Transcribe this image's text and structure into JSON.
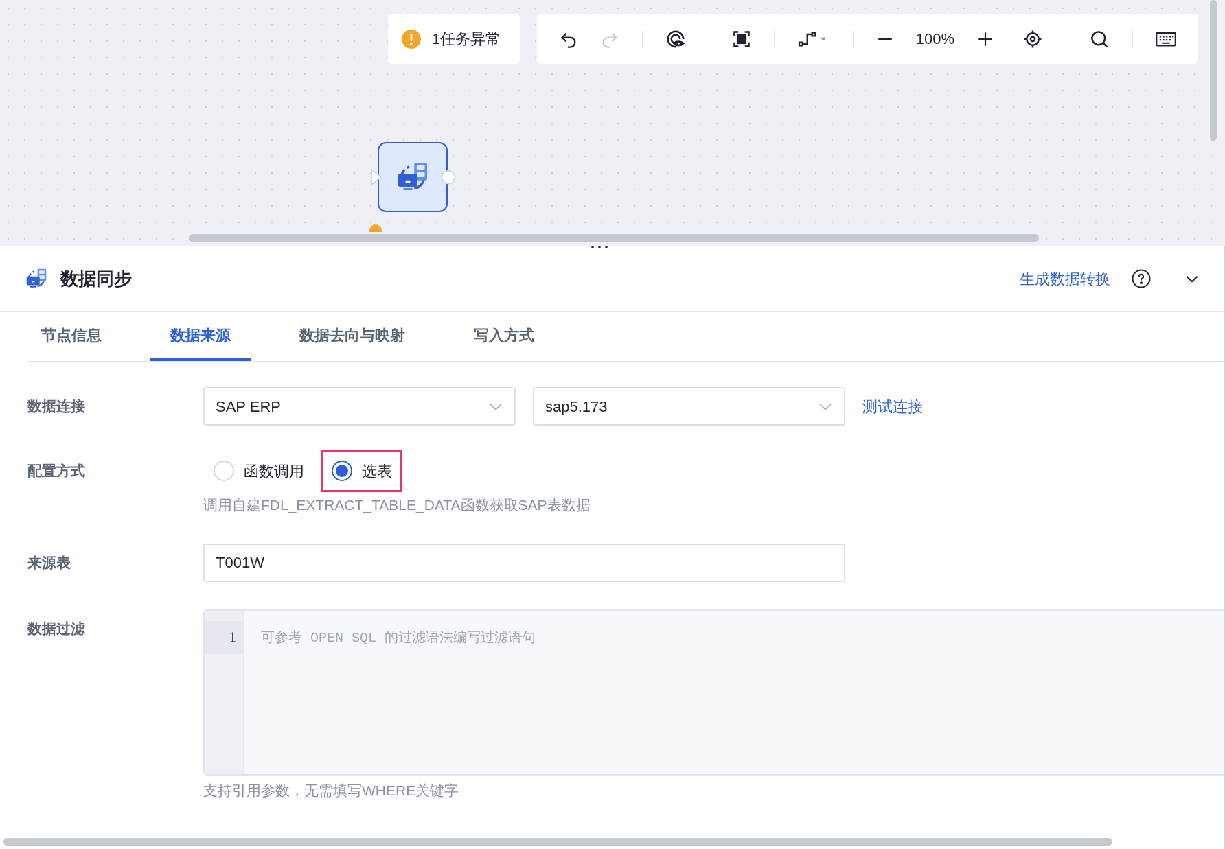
{
  "canvas": {
    "alert": {
      "text": "1任务异常"
    },
    "toolbar": {
      "zoom": "100%",
      "redo_disabled": true
    },
    "node": {
      "selected": true
    }
  },
  "panel": {
    "title": "数据同步",
    "link": "生成数据转换",
    "tabs": [
      {
        "label": "节点信息",
        "selected": false
      },
      {
        "label": "数据来源",
        "selected": true
      },
      {
        "label": "数据去向与映射",
        "selected": false
      },
      {
        "label": "写入方式",
        "selected": false
      }
    ],
    "form": {
      "connection": {
        "label": "数据连接",
        "type_value": "SAP ERP",
        "name_value": "sap5.173",
        "test_link": "测试连接"
      },
      "config": {
        "label": "配置方式",
        "options": [
          {
            "label": "函数调用",
            "selected": false,
            "highlighted": false
          },
          {
            "label": "选表",
            "selected": true,
            "highlighted": true
          }
        ],
        "hint": "调用自建FDL_EXTRACT_TABLE_DATA函数获取SAP表数据"
      },
      "source_table": {
        "label": "来源表",
        "value": "T001W"
      },
      "filter": {
        "label": "数据过滤",
        "line_numbers": [
          "1"
        ],
        "placeholder": "可参考 OPEN SQL 的过滤语法编写过滤语句",
        "hint": "支持引用参数，无需填写WHERE关键字"
      }
    }
  }
}
